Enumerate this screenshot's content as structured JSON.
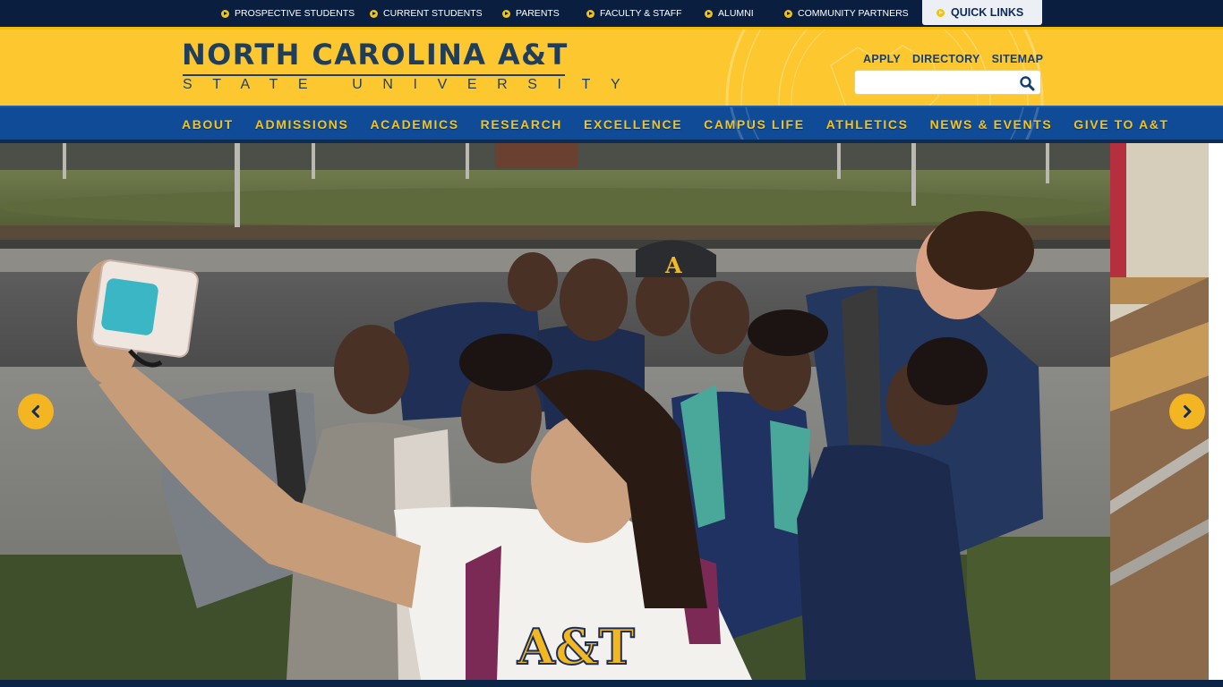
{
  "top_bar": {
    "links": [
      "PROSPECTIVE STUDENTS",
      "CURRENT STUDENTS",
      "PARENTS",
      "FACULTY & STAFF",
      "ALUMNI",
      "COMMUNITY PARTNERS"
    ],
    "quick_links_label": "QUICK LINKS"
  },
  "header": {
    "logo_main": "NORTH CAROLINA A&T",
    "logo_sub": "STATE UNIVERSITY",
    "util_links": [
      "APPLY",
      "DIRECTORY",
      "SITEMAP"
    ],
    "search": {
      "value": "",
      "placeholder": ""
    }
  },
  "nav": {
    "items": [
      "ABOUT",
      "ADMISSIONS",
      "ACADEMICS",
      "RESEARCH",
      "EXCELLENCE",
      "CAMPUS LIFE",
      "ATHLETICS",
      "NEWS & EVENTS",
      "GIVE TO A&T"
    ]
  },
  "hero": {
    "photo_description_icon": "group-selfie-photo",
    "shirt_text_main": "A&T",
    "cap_logo": "A",
    "prev_icon": "chevron-left-icon",
    "next_icon": "chevron-right-icon"
  },
  "colors": {
    "navy": "#0a1e40",
    "gold": "#fdc82f",
    "blue_nav": "#0f4b96",
    "nav_text": "#f4c31e",
    "logo_text": "#1f3e5e",
    "arrow_gold": "#f4b522"
  }
}
